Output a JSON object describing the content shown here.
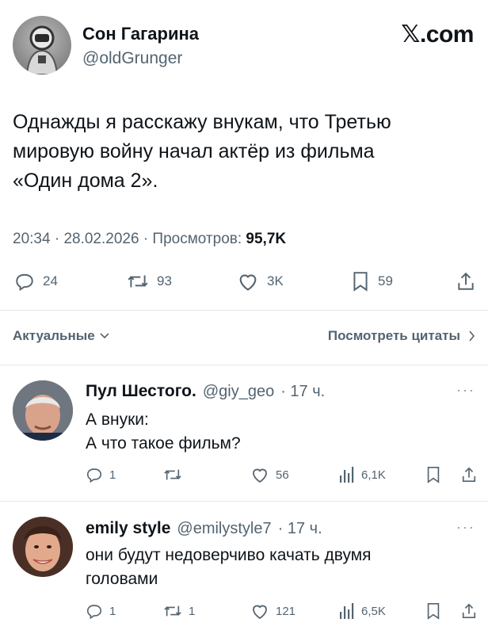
{
  "brand": "𝕏.com",
  "tweet": {
    "author_name": "Сон Гагарина",
    "author_handle": "@oldGrunger",
    "text_lines": [
      "Однажды я расскажу внукам, что Третью",
      "мировую войну начал актёр из фильма",
      "«Один дома 2»."
    ],
    "time": "20:34",
    "date": "28.02.2026",
    "views_label": "Просмотров:",
    "views": "95,7K",
    "replies": "24",
    "reposts": "93",
    "likes": "3K",
    "bookmarks": "59"
  },
  "sort_label": "Актуальные",
  "quotes_label": "Посмотреть цитаты",
  "replies": [
    {
      "name": "Пул Шестого.",
      "handle": "@giy_geo",
      "time": "· 17 ч.",
      "text_lines": [
        "А внуки:",
        "А что такое фильм?"
      ],
      "replies": "1",
      "reposts": "",
      "likes": "56",
      "views": "6,1K"
    },
    {
      "name": "emily style",
      "handle": "@emilystyle7",
      "time": "· 17 ч.",
      "text_lines": [
        "они будут недоверчиво качать двумя",
        "головами"
      ],
      "replies": "1",
      "reposts": "1",
      "likes": "121",
      "views": "6,5K"
    }
  ],
  "icons": {
    "reply": "speech-bubble",
    "repost": "two-arrows",
    "like": "heart",
    "bookmark": "bookmark",
    "share": "share-up-arrow",
    "views": "bar-chart",
    "more": "ellipsis",
    "chevron": "chevron"
  },
  "colors": {
    "text": "#0f1419",
    "secondary": "#536471",
    "divider": "#e6e8ea"
  }
}
